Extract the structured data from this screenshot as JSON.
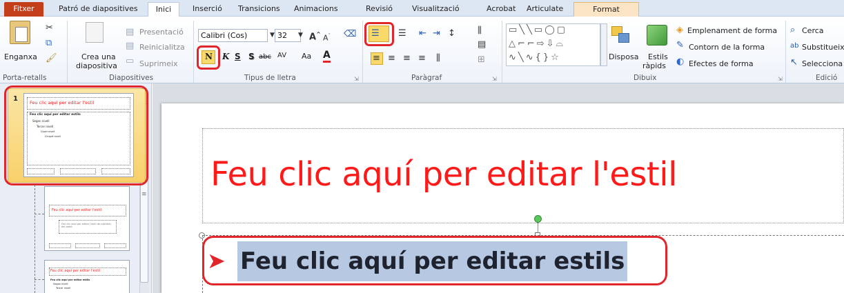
{
  "tabs": {
    "file": "Fitxer",
    "slide_master": "Patró de diapositives",
    "home": "Inici",
    "insert": "Inserció",
    "transitions": "Transicions",
    "animations": "Animacions",
    "review": "Revisió",
    "view": "Visualització",
    "acrobat": "Acrobat",
    "articulate": "Articulate",
    "format": "Format"
  },
  "clipboard": {
    "paste": "Enganxa",
    "group": "Porta-retalls"
  },
  "slides": {
    "new_slide_1": "Crea una",
    "new_slide_2": "diapositiva",
    "layout": "Presentació",
    "reset": "Reinicialitza",
    "delete": "Suprimeix",
    "group": "Diapositives"
  },
  "font": {
    "name": "Calibri (Cos)",
    "size": "32",
    "bold": "N",
    "italic": "K",
    "underline": "S",
    "shadow": "S",
    "strike": "abc",
    "spacing": "AV",
    "case": "Aa",
    "color": "A",
    "group": "Tipus de lletra"
  },
  "paragraph": {
    "group": "Paràgraf"
  },
  "drawing": {
    "arrange": "Disposa",
    "quick_styles_1": "Estils",
    "quick_styles_2": "ràpids",
    "shape_fill": "Emplenament de forma",
    "shape_outline": "Contorn de la forma",
    "shape_effects": "Efectes de forma",
    "group": "Dibuix"
  },
  "editing": {
    "find": "Cerca",
    "replace": "Substitueix",
    "select": "Selecciona",
    "group": "Edició"
  },
  "thumbnails": {
    "slide1_number": "1",
    "slide1_title": "Feu clic aquí per editar l'estil",
    "slide1_body": [
      "Feu clic aquí per editar estils",
      "Segon nivell",
      "Tercer nivell",
      "Quart nivell",
      "Cinquè nivell"
    ],
    "slide2_title": "Feu clic aquí per editar l'estil",
    "slide2_body": "Feu clic aquí per editar l'estil de subtítols del patró",
    "slide3_title": "Feu clic aquí per editar l'estil",
    "slide3_body": [
      "Feu clic aquí per editar estils",
      "Segon nivell",
      "Tercer nivell"
    ]
  },
  "slide": {
    "title": "Feu clic aquí per editar l'estil",
    "bullet": "Feu clic aquí per editar estils"
  },
  "colors": {
    "title_red": "#ff1a1a",
    "highlight_red": "#e0262a",
    "file_tab": "#c43e1c",
    "selection": "#b7c9e2"
  }
}
